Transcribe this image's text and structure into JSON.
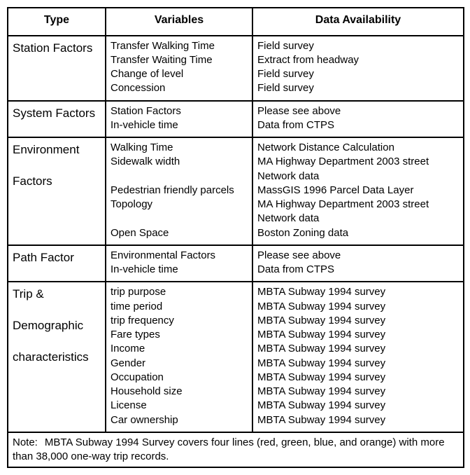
{
  "headers": {
    "type": "Type",
    "variables": "Variables",
    "availability": "Data Availability"
  },
  "rows": [
    {
      "type_lines": [
        "Station Factors"
      ],
      "type_single": true,
      "variables": [
        "Transfer Walking Time",
        "Transfer Waiting Time",
        "Change of level",
        "Concession"
      ],
      "availability": [
        "Field survey",
        "Extract from headway",
        "Field survey",
        "Field survey"
      ]
    },
    {
      "type_lines": [
        "System Factors"
      ],
      "type_single": true,
      "variables": [
        "Station Factors",
        "In-vehicle time"
      ],
      "availability": [
        "Please see above",
        "Data from CTPS"
      ]
    },
    {
      "type_lines": [
        "Environment",
        "Factors"
      ],
      "type_single": false,
      "variables": [
        "Walking Time",
        "Sidewalk width",
        "",
        "Pedestrian friendly parcels",
        "Topology",
        "",
        "Open Space"
      ],
      "availability": [
        "Network Distance Calculation",
        "MA Highway Department 2003 street",
        "Network data",
        "MassGIS 1996 Parcel Data Layer",
        "MA Highway Department 2003 street",
        "Network data",
        "Boston Zoning data"
      ]
    },
    {
      "type_lines": [
        "Path Factor"
      ],
      "type_single": true,
      "variables": [
        "Environmental Factors",
        "In-vehicle time"
      ],
      "availability": [
        "Please see above",
        "Data from CTPS"
      ]
    },
    {
      "type_lines": [
        "Trip &",
        "Demographic",
        "characteristics"
      ],
      "type_single": false,
      "variables": [
        "trip purpose",
        "time period",
        "trip frequency",
        "Fare types",
        "Income",
        "Gender",
        "Occupation",
        "Household size",
        "License",
        "Car ownership"
      ],
      "availability": [
        "MBTA Subway 1994  survey",
        "MBTA Subway 1994  survey",
        "MBTA Subway 1994  survey",
        "MBTA Subway 1994  survey",
        "MBTA Subway 1994  survey",
        "MBTA Subway 1994  survey",
        "MBTA Subway 1994  survey",
        "MBTA Subway 1994  survey",
        "MBTA Subway 1994  survey",
        "MBTA Subway 1994  survey"
      ]
    }
  ],
  "note": {
    "label": "Note:",
    "text": "MBTA Subway 1994 Survey covers four lines (red, green, blue, and orange) with more than 38,000 one-way trip records."
  }
}
